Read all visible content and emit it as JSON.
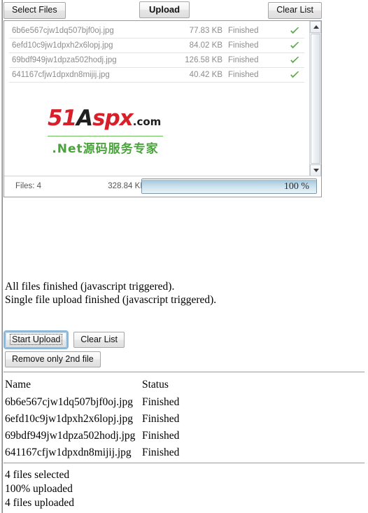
{
  "toolbar": {
    "select_files_label": "Select Files",
    "upload_label": "Upload",
    "clear_list_label": "Clear List"
  },
  "queue": {
    "rows": [
      {
        "name": "6b6e567cjw1dq507bjf0oj.jpg",
        "size": "77.83 KB",
        "status": "Finished",
        "icon": "green-check-icon"
      },
      {
        "name": "6efd10c9jw1dpxh2x6lopj.jpg",
        "size": "84.02 KB",
        "status": "Finished",
        "icon": "green-check-icon"
      },
      {
        "name": "69bdf949jw1dpza502hodj.jpg",
        "size": "126.58 KB",
        "status": "Finished",
        "icon": "green-check-icon"
      },
      {
        "name": "641167cfjw1dpxdn8mijij.jpg",
        "size": "40.42 KB",
        "status": "Finished",
        "icon": "green-check-icon"
      }
    ],
    "totals": {
      "files_label": "Files: 4",
      "total_size": "328.84 KB",
      "progress_label": "100 %",
      "progress_percent": 100
    },
    "scrollbar": {
      "up_icon": "triangle-up-icon",
      "down_icon": "triangle-down-icon"
    }
  },
  "watermark": {
    "part_51": "51",
    "part_a": "A",
    "part_spx": "spx",
    "part_dot_com": ".com",
    "tagline": ".Net源码服务专家"
  },
  "messages": {
    "line1": "All files finished (javascript triggered).",
    "line2": "Single file upload finished (javascript triggered)."
  },
  "actions": {
    "start_upload_label": "Start Upload",
    "clear_list_label": "Clear List",
    "remove_second_label": "Remove only 2nd file"
  },
  "table": {
    "headers": {
      "name": "Name",
      "status": "Status"
    },
    "rows": [
      {
        "name": "6b6e567cjw1dq507bjf0oj.jpg",
        "status": "Finished"
      },
      {
        "name": "6efd10c9jw1dpxh2x6lopj.jpg",
        "status": "Finished"
      },
      {
        "name": "69bdf949jw1dpza502hodj.jpg",
        "status": "Finished"
      },
      {
        "name": "641167cfjw1dpxdn8mijij.jpg",
        "status": "Finished"
      }
    ]
  },
  "summary": {
    "line1": "4 files selected",
    "line2": "100% uploaded",
    "line3": "4 files uploaded"
  },
  "colors": {
    "check_green": "#5fa84e",
    "watermark_red": "#d8202a",
    "watermark_green": "#4aa33c",
    "progress_blue": "#9ec4d9"
  }
}
